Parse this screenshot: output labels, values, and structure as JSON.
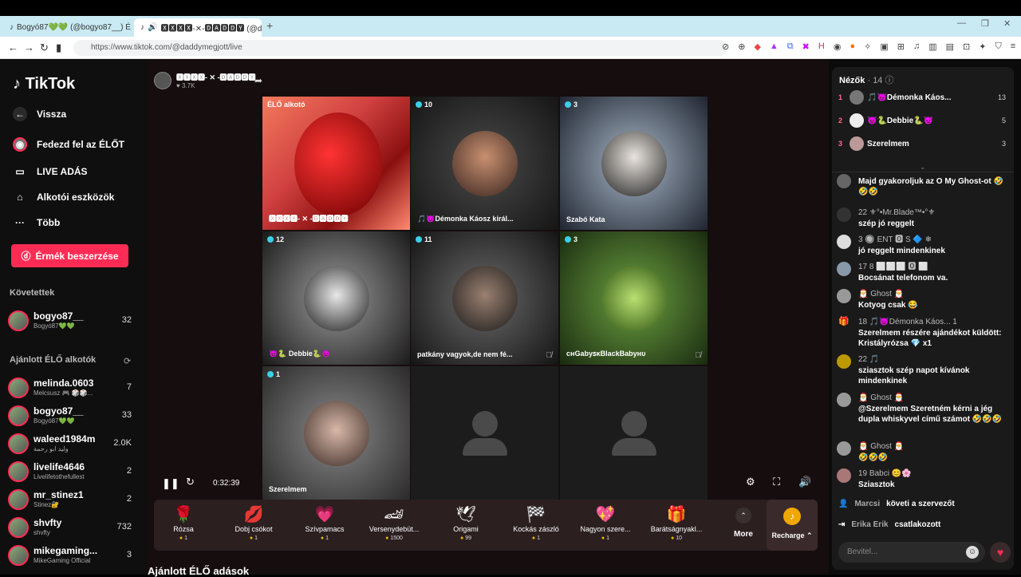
{
  "browser": {
    "tab1_title": "Bogyó87💚💚 (@bogyo87__) É...",
    "tab2_title": "🆇🆇🆇🆇-✕-🅳🅰🅳🅳🆈 (@daddymegjott)",
    "url": "https://www.tiktok.com/@daddymegjott/live"
  },
  "sidebar": {
    "logo": "TikTok",
    "back": "Vissza",
    "discover": "Fedezd fel az ÉLŐT",
    "live": "LIVE ADÁS",
    "tools": "Alkotói eszközök",
    "more": "Több",
    "earn": "Érmék beszerzése",
    "following_title": "Követettek",
    "following": [
      {
        "name": "bogyo87__",
        "sub": "Bogyó87💚💚",
        "count": "32"
      }
    ],
    "recommended_title": "Ajánlott ÉLŐ alkotók",
    "recommended": [
      {
        "name": "melinda.0603",
        "sub": "Melcsusz 🎮 🎲🎲...",
        "count": "7"
      },
      {
        "name": "bogyo87__",
        "sub": "Bogyó87💚💚",
        "count": "33"
      },
      {
        "name": "waleed1984m",
        "sub": "وليد ابو رحمة",
        "count": "2.0K"
      },
      {
        "name": "livelife4646",
        "sub": "Livelifetothefullest",
        "count": "2"
      },
      {
        "name": "mr_stinez1",
        "sub": "Stinez🔐",
        "count": "2"
      },
      {
        "name": "shvfty",
        "sub": "shvfty",
        "count": "732"
      },
      {
        "name": "mikegaming...",
        "sub": "MikeGaming Official",
        "count": "3"
      }
    ]
  },
  "host": {
    "name": "🆇🆇🆇🆇- ✕ -🅳🅰🅳🅳🆈",
    "likes": "♥ 3.7K"
  },
  "grid": [
    {
      "badge": "ÉLŐ alkotó",
      "label": "🆇🆇🆇🆇- ✕ -🅳🅰🅳🅳🆈"
    },
    {
      "badge": "10",
      "label": "🎵😈Démonka Káosz királ..."
    },
    {
      "badge": "3",
      "label": "Szabó Kata"
    },
    {
      "badge": "12",
      "label": "😈🐍 Debbie🐍😈"
    },
    {
      "badge": "11",
      "label": "patkány vagyok,de nem fé..."
    },
    {
      "badge": "3",
      "label": "ᴄʜGabyꜱᴋBlackBabyʜᴜ"
    },
    {
      "badge": "1",
      "label": "Szerelmem"
    }
  ],
  "player": {
    "time": "0:32:39"
  },
  "gifts": [
    {
      "name": "Rózsa",
      "price": "1",
      "icon": "🌹"
    },
    {
      "name": "Dobj csókot",
      "price": "1",
      "icon": "💋"
    },
    {
      "name": "Szívpamacs",
      "price": "1",
      "icon": "💗"
    },
    {
      "name": "Versenydebüt...",
      "price": "1500",
      "icon": "🏎"
    },
    {
      "name": "Origami",
      "price": "99",
      "icon": "🕊"
    },
    {
      "name": "Kockás zászló",
      "price": "1",
      "icon": "🏁"
    },
    {
      "name": "Nagyon szere...",
      "price": "1",
      "icon": "💖"
    },
    {
      "name": "Barátságnyakl...",
      "price": "10",
      "icon": "🎁"
    }
  ],
  "more_label": "More",
  "recharge_label": "Recharge ⌃",
  "bottom_title": "Ajánlott ÉLŐ adások",
  "chat": {
    "viewers_label": "Nézők",
    "viewers_count": "· 14",
    "viewers": [
      {
        "rank": "1",
        "name": "🎵😈Démonka Káos...",
        "score": "13"
      },
      {
        "rank": "2",
        "name": "😈🐍Debbie🐍😈",
        "score": "5"
      },
      {
        "rank": "3",
        "name": "Szerelmem",
        "score": "3"
      }
    ],
    "messages": [
      {
        "user": "",
        "text": "Majd gyakoroljuk az O My Ghost-ot 🤣🤣🤣"
      },
      {
        "user": "22 ⚜°•Mr.Blade™•°⚜",
        "text": "szép jó reggelt"
      },
      {
        "user": "3 🔘 ENT 🅾 S 🔷 ❄",
        "text": "jó reggelt mindenkinek"
      },
      {
        "user": "17 8 ⬜⬜⬜ 🅾 ⬜",
        "text": "Bocsánat telefonom va."
      },
      {
        "user": "🎅 Ghost 🎅",
        "text": "Kotyog csak 😂"
      },
      {
        "user": "18 🎵😈Démonka Káos... 1",
        "text": "Szerelmem részére ajándékot küldött: Kristályrózsa 💎 x1"
      },
      {
        "user": "22 🎵",
        "text": "sziasztok szép napot kívánok mindenkinek"
      },
      {
        "user": "🎅 Ghost 🎅",
        "text": "@Szerelmem Szeretném kérni a jég dupla whiskyvel című számot 🤣🤣🤣"
      },
      {
        "user": "🎅 Ghost 🎅",
        "text": "🤣🤣🤣"
      },
      {
        "user": "19 Babci 😊🌸",
        "text": "Sziasztok"
      }
    ],
    "sys1_user": "Marcsi",
    "sys1_text": "követi a szervezőt",
    "sys2_user": "Erika Erik",
    "sys2_text": "csatlakozott",
    "input_placeholder": "Bevitel..."
  },
  "colors": {
    "accent": "#fe2c55",
    "badge": "#3bd0e8",
    "level": "#4c5bff"
  }
}
